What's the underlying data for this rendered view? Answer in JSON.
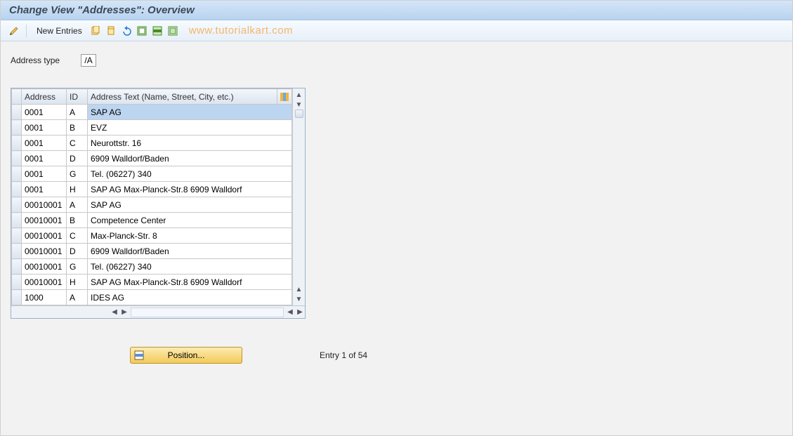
{
  "title": "Change View \"Addresses\": Overview",
  "toolbar": {
    "new_entries_label": "New Entries",
    "watermark": "www.tutorialkart.com"
  },
  "field": {
    "label": "Address type",
    "value": "/A"
  },
  "table": {
    "columns": {
      "address": "Address",
      "id": "ID",
      "text": "Address Text (Name, Street, City, etc.)"
    },
    "rows": [
      {
        "address": "0001",
        "id": "A",
        "text": "SAP AG",
        "selected": true
      },
      {
        "address": "0001",
        "id": "B",
        "text": "EVZ"
      },
      {
        "address": "0001",
        "id": "C",
        "text": "Neurottstr. 16"
      },
      {
        "address": "0001",
        "id": "D",
        "text": "6909   Walldorf/Baden"
      },
      {
        "address": "0001",
        "id": "G",
        "text": "Tel. (06227) 340"
      },
      {
        "address": "0001",
        "id": "H",
        "text": "SAP AG Max-Planck-Str.8 6909 Walldorf"
      },
      {
        "address": "00010001",
        "id": "A",
        "text": "SAP AG"
      },
      {
        "address": "00010001",
        "id": "B",
        "text": "Competence Center"
      },
      {
        "address": "00010001",
        "id": "C",
        "text": "Max-Planck-Str. 8"
      },
      {
        "address": "00010001",
        "id": "D",
        "text": "6909   Walldorf/Baden"
      },
      {
        "address": "00010001",
        "id": "G",
        "text": "Tel. (06227) 340"
      },
      {
        "address": "00010001",
        "id": "H",
        "text": "SAP AG Max-Planck-Str.8 6909 Walldorf"
      },
      {
        "address": "1000",
        "id": "A",
        "text": "IDES AG"
      }
    ]
  },
  "footer": {
    "position_label": "Position...",
    "entry_text": "Entry 1 of 54"
  }
}
